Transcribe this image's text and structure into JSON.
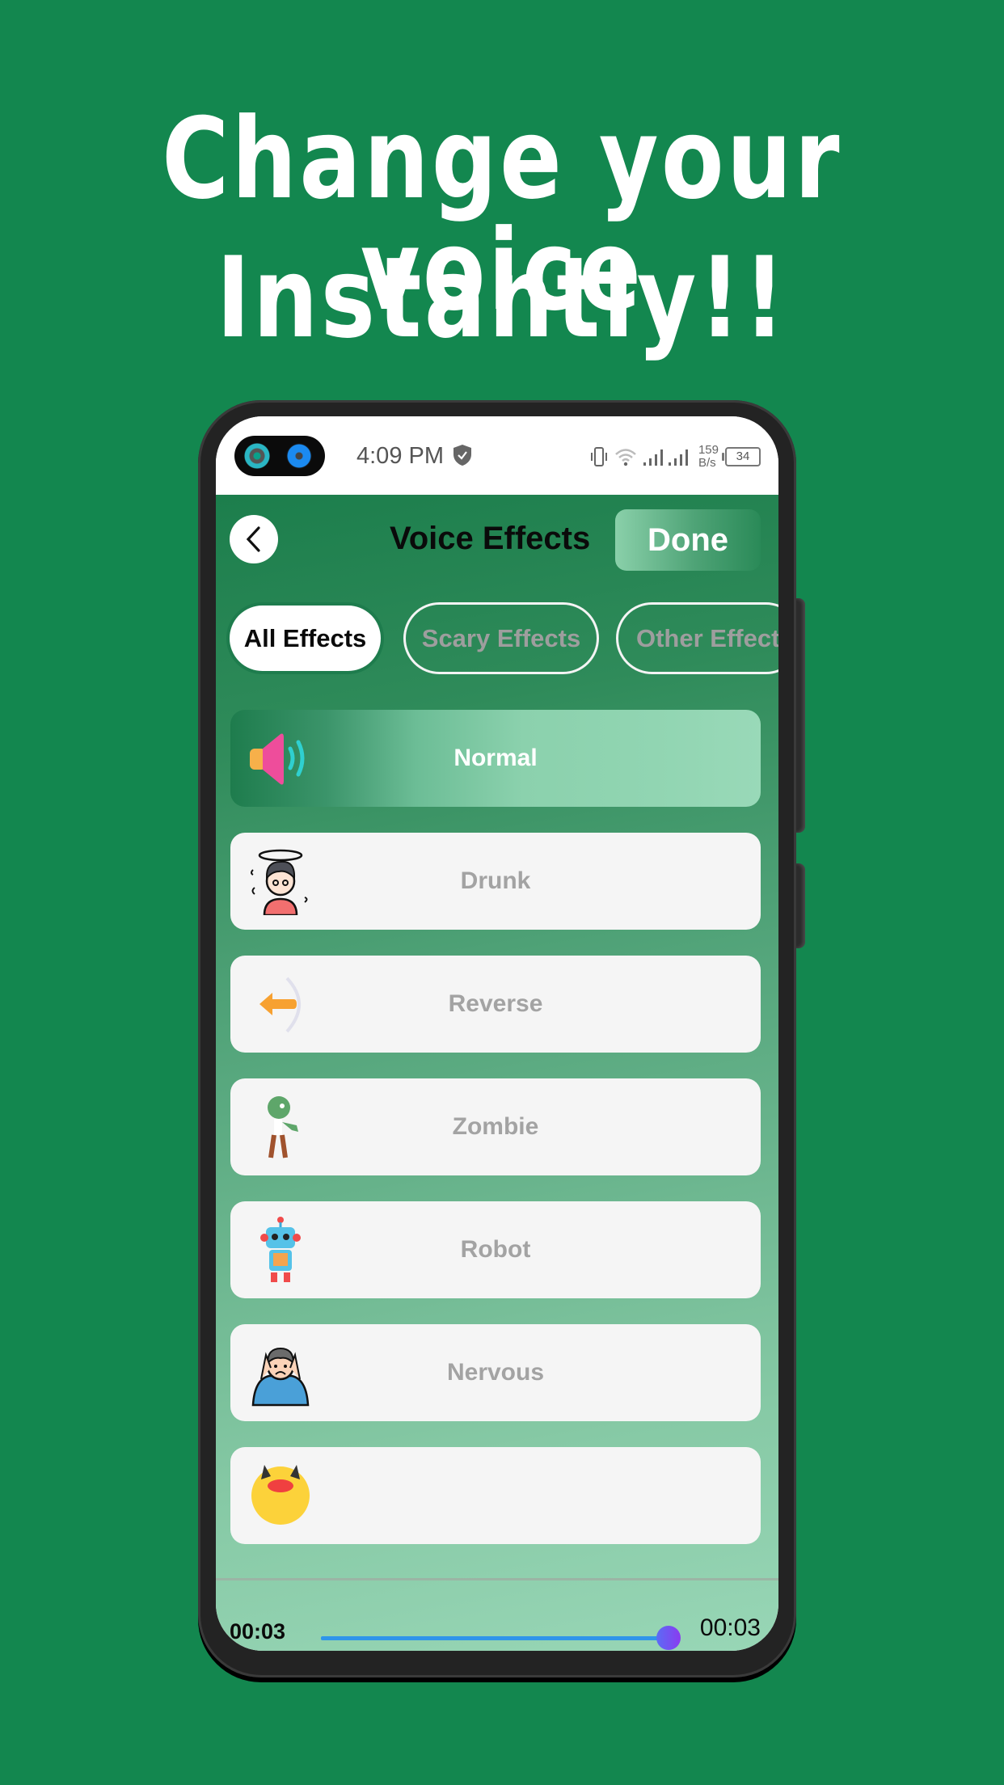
{
  "promo": {
    "headline_line1": "Change your voice",
    "headline_line2": "Instantly!!",
    "background_color": "#13874f"
  },
  "status_bar": {
    "time": "4:09 PM",
    "net_speed_value": "159",
    "net_speed_unit": "B/s",
    "battery": "34"
  },
  "header": {
    "title": "Voice Effects",
    "done_label": "Done"
  },
  "tabs": [
    {
      "label": "All Effects",
      "active": true
    },
    {
      "label": "Scary Effects",
      "active": false
    },
    {
      "label": "Other Effects",
      "active": false
    }
  ],
  "effects": [
    {
      "label": "Normal",
      "icon": "speaker-icon",
      "selected": true
    },
    {
      "label": "Drunk",
      "icon": "dizzy-man-icon",
      "selected": false
    },
    {
      "label": "Reverse",
      "icon": "reverse-arrow-icon",
      "selected": false
    },
    {
      "label": "Zombie",
      "icon": "zombie-icon",
      "selected": false
    },
    {
      "label": "Robot",
      "icon": "robot-icon",
      "selected": false
    },
    {
      "label": "Nervous",
      "icon": "nervous-man-icon",
      "selected": false
    },
    {
      "label": "",
      "icon": "devil-icon",
      "selected": false
    }
  ],
  "player": {
    "current_time": "00:03",
    "total_time": "00:03",
    "progress": 1.0,
    "accent_color": "#2f95ea"
  }
}
